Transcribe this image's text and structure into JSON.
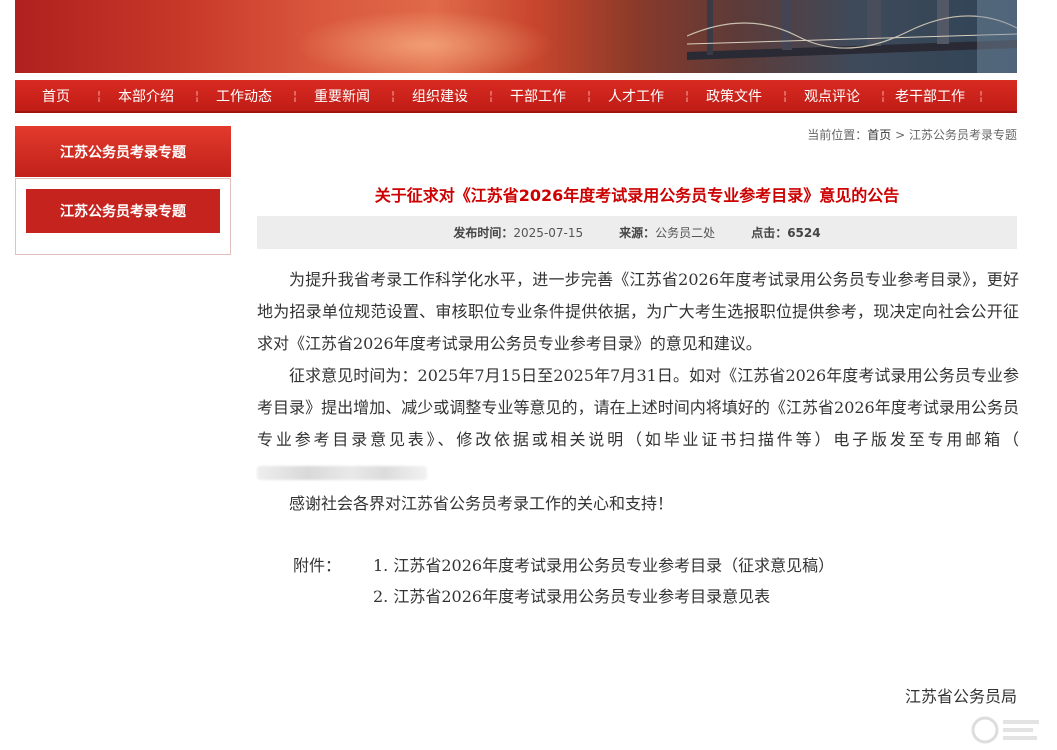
{
  "nav": [
    "首页",
    "本部介绍",
    "工作动态",
    "重要新闻",
    "组织建设",
    "干部工作",
    "人才工作",
    "政策文件",
    "观点评论",
    "老干部工作"
  ],
  "sidebar": {
    "title": "江苏公务员考录专题",
    "item": "江苏公务员考录专题"
  },
  "breadcrumb": {
    "prefix": "当前位置：",
    "home": "首页",
    "sep": ">",
    "current": "江苏公务员考录专题"
  },
  "article": {
    "title": "关于征求对《江苏省2026年度考试录用公务员专业参考目录》意见的公告",
    "publish_label": "发布时间：",
    "publish_date": "2025-07-15",
    "source_label": "来源：",
    "source": "公务员二处",
    "clicks_label": "点击：",
    "clicks": "6524",
    "para1": "为提升我省考录工作科学化水平，进一步完善《江苏省2026年度考试录用公务员专业参考目录》，更好地为招录单位规范设置、审核职位专业条件提供依据，为广大考生选报职位提供参考，现决定向社会公开征求对《江苏省2026年度考试录用公务员专业参考目录》的意见和建议。",
    "para2": "征求意见时间为：2025年7月15日至2025年7月31日。如对《江苏省2026年度考试录用公务员专业参考目录》提出增加、减少或调整专业等意见的，请在上述时间内将填好的《江苏省2026年度考试录用公务员专业参考目录意见表》、修改依据或相关说明（如毕业证书扫描件等）电子版发至专用邮箱（",
    "para3": "感谢社会各界对江苏省公务员考录工作的关心和支持！",
    "attach_label": "附件：",
    "attach1": "1. 江苏省2026年度考试录用公务员专业参考目录（征求意见稿）",
    "attach2": "2. 江苏省2026年度考试录用公务员专业参考目录意见表",
    "signature": "江苏省公务员局"
  },
  "colors": {
    "primary_red": "#c5231d",
    "title_red": "#cc0000"
  }
}
